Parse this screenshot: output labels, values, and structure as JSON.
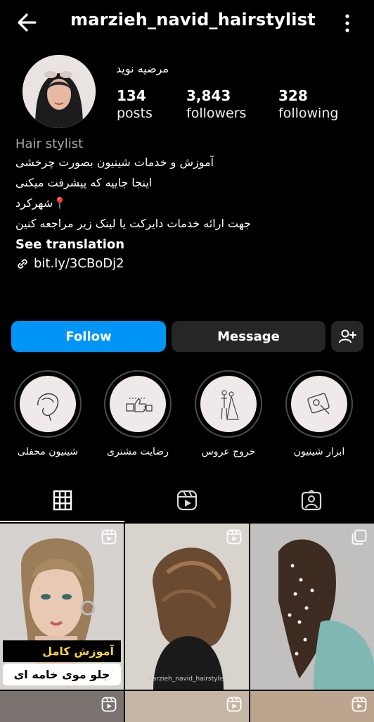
{
  "header": {
    "username": "marzieh_navid_hairstylist",
    "back_icon": "arrow-left-icon",
    "more_icon": "more-vertical-icon"
  },
  "profile": {
    "full_name": "مرضیه نوید",
    "stats": [
      {
        "value": "134",
        "label": "posts"
      },
      {
        "value": "3,843",
        "label": "followers"
      },
      {
        "value": "328",
        "label": "following"
      }
    ]
  },
  "bio": {
    "category": "Hair stylist",
    "lines": [
      "آموزش و خدمات شینیون بصورت چرخشی",
      "اینجا جاییه که پیشرفت میکنی",
      "📍شهرکرد",
      "جهت ارائه خدمات دایرکت یا لینک زیر مراجعه کنین"
    ],
    "see_translation": "See translation",
    "link": "bit.ly/3CBoDj2"
  },
  "actions": {
    "follow": "Follow",
    "message": "Message"
  },
  "highlights": [
    {
      "label": "شینیون محفلی"
    },
    {
      "label": "رضایت مشتری"
    },
    {
      "label": "خروج عروس"
    },
    {
      "label": "ابزار شینیون"
    }
  ],
  "posts": {
    "overlay_line1": "آموزش کامل",
    "overlay_line2": "جلو موی خامه ای",
    "watermark": "Marzieh_navid_hairstylist"
  },
  "colors": {
    "accent": "#0095f6",
    "button_dark": "#262626",
    "background": "#000000"
  }
}
